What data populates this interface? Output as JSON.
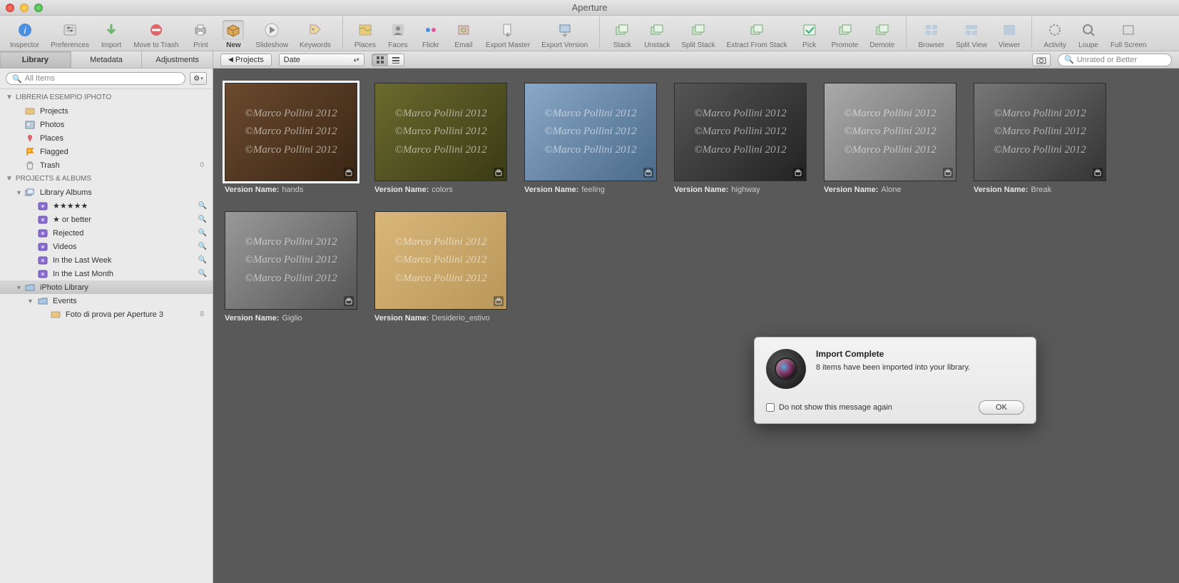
{
  "window": {
    "title": "Aperture"
  },
  "toolbar": {
    "groups": [
      [
        {
          "id": "inspector",
          "label": "Inspector",
          "icon": "info-icon"
        },
        {
          "id": "preferences",
          "label": "Preferences",
          "icon": "sliders-icon"
        },
        {
          "id": "import",
          "label": "Import",
          "icon": "download-arrow-icon"
        },
        {
          "id": "move-to-trash",
          "label": "Move to Trash",
          "icon": "no-entry-icon"
        },
        {
          "id": "print",
          "label": "Print",
          "icon": "printer-icon"
        },
        {
          "id": "new",
          "label": "New",
          "icon": "box-icon",
          "selected": true
        },
        {
          "id": "slideshow",
          "label": "Slideshow",
          "icon": "play-icon"
        },
        {
          "id": "keywords",
          "label": "Keywords",
          "icon": "tag-icon"
        }
      ],
      [
        {
          "id": "places",
          "label": "Places",
          "icon": "map-icon"
        },
        {
          "id": "faces",
          "label": "Faces",
          "icon": "person-icon"
        },
        {
          "id": "flickr",
          "label": "Flickr",
          "icon": "dots-icon"
        },
        {
          "id": "email",
          "label": "Email",
          "icon": "stamp-icon"
        },
        {
          "id": "export-master",
          "label": "Export Master",
          "icon": "file-out-icon"
        },
        {
          "id": "export-version",
          "label": "Export Version",
          "icon": "image-out-icon"
        }
      ],
      [
        {
          "id": "stack",
          "label": "Stack",
          "icon": "stack-icon"
        },
        {
          "id": "unstack",
          "label": "Unstack",
          "icon": "unstack-icon"
        },
        {
          "id": "split-stack",
          "label": "Split Stack",
          "icon": "split-stack-icon"
        },
        {
          "id": "extract-from-stack",
          "label": "Extract From Stack",
          "icon": "extract-icon"
        },
        {
          "id": "pick",
          "label": "Pick",
          "icon": "check-icon"
        },
        {
          "id": "promote",
          "label": "Promote",
          "icon": "promote-icon"
        },
        {
          "id": "demote",
          "label": "Demote",
          "icon": "demote-icon"
        }
      ],
      [
        {
          "id": "browser",
          "label": "Browser",
          "icon": "grid-icon"
        },
        {
          "id": "split-view",
          "label": "Split View",
          "icon": "split-view-icon"
        },
        {
          "id": "viewer",
          "label": "Viewer",
          "icon": "viewer-icon"
        }
      ],
      [
        {
          "id": "activity",
          "label": "Activity",
          "icon": "spinner-icon"
        },
        {
          "id": "loupe",
          "label": "Loupe",
          "icon": "loupe-icon"
        },
        {
          "id": "full-screen",
          "label": "Full Screen",
          "icon": "fullscreen-icon"
        }
      ]
    ]
  },
  "inspector_tabs": [
    "Library",
    "Metadata",
    "Adjustments"
  ],
  "inspector_active": 0,
  "browser_bar": {
    "scope": "Projects",
    "sort": "Date",
    "view_grid": true,
    "filter_placeholder": "Unrated or Better"
  },
  "sidebar": {
    "search_placeholder": "All Items",
    "sections": [
      {
        "heading": "LIBRERIA ESEMPIO IPHOTO",
        "items": [
          {
            "label": "Projects",
            "icon": "projects-icon"
          },
          {
            "label": "Photos",
            "icon": "photos-icon"
          },
          {
            "label": "Places",
            "icon": "pin-icon"
          },
          {
            "label": "Flagged",
            "icon": "flag-icon"
          },
          {
            "label": "Trash",
            "icon": "trash-icon",
            "count": "0"
          }
        ]
      },
      {
        "heading": "PROJECTS & ALBUMS",
        "items": [
          {
            "label": "Library Albums",
            "icon": "albums-icon",
            "expandable": true,
            "expanded": true,
            "children": [
              {
                "label": "★★★★★",
                "icon": "smart-album-icon",
                "right": "search"
              },
              {
                "label": "★ or better",
                "icon": "smart-album-icon",
                "right": "search"
              },
              {
                "label": "Rejected",
                "icon": "smart-album-icon",
                "right": "search"
              },
              {
                "label": "Videos",
                "icon": "smart-album-icon",
                "right": "search"
              },
              {
                "label": "In the Last Week",
                "icon": "smart-album-icon",
                "right": "search"
              },
              {
                "label": "In the Last Month",
                "icon": "smart-album-icon",
                "right": "search"
              }
            ]
          },
          {
            "label": "iPhoto Library",
            "icon": "folder-icon",
            "expandable": true,
            "expanded": true,
            "selected": true,
            "children": [
              {
                "label": "Events",
                "icon": "folder-icon",
                "expandable": true,
                "expanded": true,
                "children": [
                  {
                    "label": "Foto di prova per Aperture 3",
                    "icon": "project-icon",
                    "count": "8"
                  }
                ]
              }
            ]
          }
        ]
      }
    ]
  },
  "grid": {
    "caption_label": "Version Name:",
    "watermark": "©Marco Pollini 2012",
    "items": [
      {
        "name": "hands",
        "bw": false,
        "selected": true,
        "bg": 0
      },
      {
        "name": "colors",
        "bw": false,
        "selected": false,
        "bg": 1
      },
      {
        "name": "feeling",
        "bw": false,
        "selected": false,
        "bg": 2
      },
      {
        "name": "highway",
        "bw": true,
        "selected": false,
        "bg": 3
      },
      {
        "name": "Alone",
        "bw": true,
        "selected": false,
        "bg": 4
      },
      {
        "name": "Break",
        "bw": true,
        "selected": false,
        "bg": 5
      },
      {
        "name": "Giglio",
        "bw": true,
        "selected": false,
        "bg": 6
      },
      {
        "name": "Desiderio_estivo",
        "bw": false,
        "selected": false,
        "bg": 7
      }
    ]
  },
  "dialog": {
    "title": "Import Complete",
    "message": "8 items have been imported into your library.",
    "checkbox_label": "Do not show this message again",
    "ok": "OK"
  }
}
